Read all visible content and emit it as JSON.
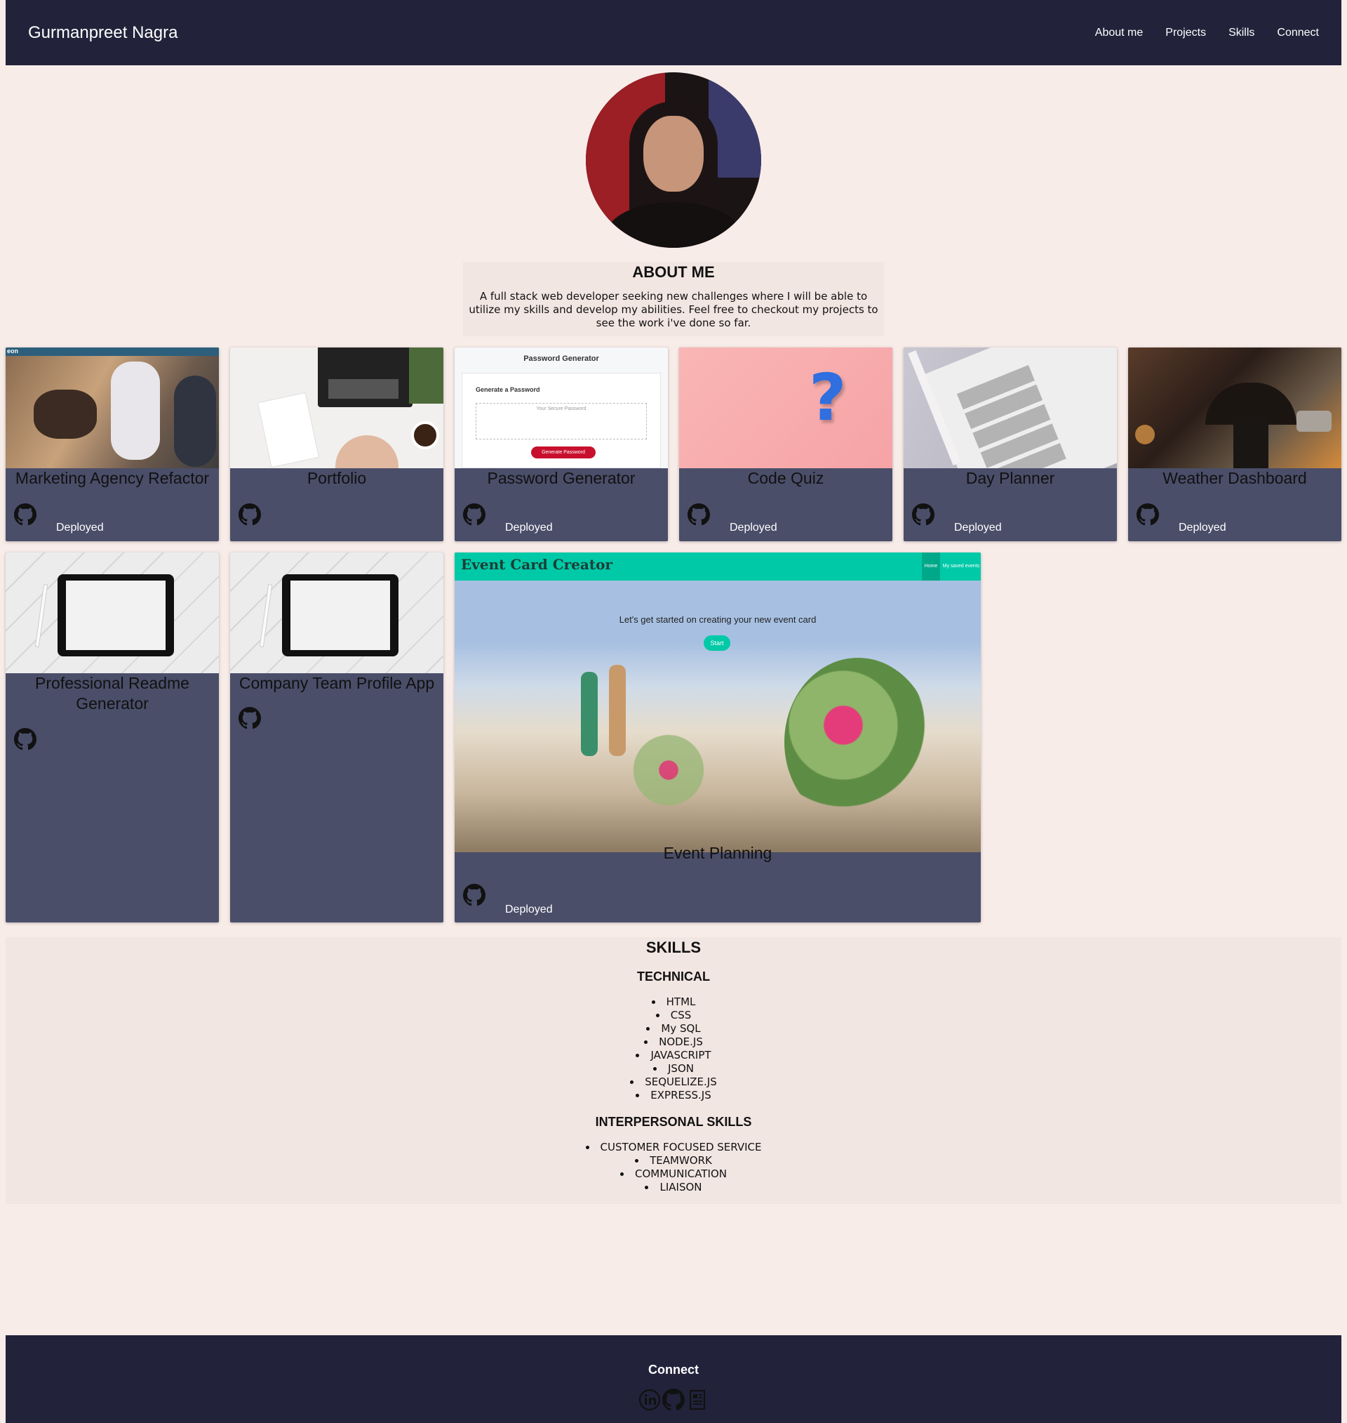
{
  "header": {
    "brand": "Gurmanpreet Nagra",
    "nav": [
      "About me",
      "Projects",
      "Skills",
      "Connect"
    ]
  },
  "about": {
    "heading": "ABOUT ME",
    "text": "A full stack web developer seeking new challenges where I will be able to utilize my skills and develop my abilities. Feel free to checkout my projects to see the work i've done so far."
  },
  "projects": [
    {
      "title": "Marketing Agency Refactor",
      "deployed": "Deployed",
      "thumb_text": "eon"
    },
    {
      "title": "Portfolio"
    },
    {
      "title": "Password Generator",
      "deployed": "Deployed",
      "thumb": {
        "heading": "Password Generator",
        "sub": "Generate a Password",
        "placeholder": "Your Secure Password",
        "button": "Generate Password"
      }
    },
    {
      "title": "Code Quiz",
      "deployed": "Deployed"
    },
    {
      "title": "Day Planner",
      "deployed": "Deployed"
    },
    {
      "title": "Weather Dashboard",
      "deployed": "Deployed"
    },
    {
      "title": "Professional Readme Generator"
    },
    {
      "title": "Company Team Profile App"
    },
    {
      "title": "Event Planning",
      "deployed": "Deployed",
      "thumb": {
        "brand": "Event Card Creator",
        "nav": [
          "Home",
          "My saved events"
        ],
        "tagline": "Let's get started on creating your new event card",
        "button": "Start"
      }
    }
  ],
  "skills": {
    "heading": "SKILLS",
    "technical_heading": "TECHNICAL",
    "technical": [
      "HTML",
      "CSS",
      "My SQL",
      "NODE.JS",
      "JAVASCRIPT",
      "JSON",
      "SEQUELIZE.JS",
      "EXPRESS.JS"
    ],
    "interpersonal_heading": "INTERPERSONAL SKILLS",
    "interpersonal": [
      "CUSTOMER FOCUSED SERVICE",
      "TEAMWORK",
      "COMMUNICATION",
      "LIAISON"
    ]
  },
  "footer": {
    "heading": "Connect",
    "icons": [
      "linkedin-icon",
      "github-icon",
      "resume-icon"
    ]
  },
  "colors": {
    "page_bg": "#f8ece9",
    "nav_bg": "#22223b",
    "card_bg": "#4a4e69",
    "section_bg": "#f2e6e2"
  }
}
